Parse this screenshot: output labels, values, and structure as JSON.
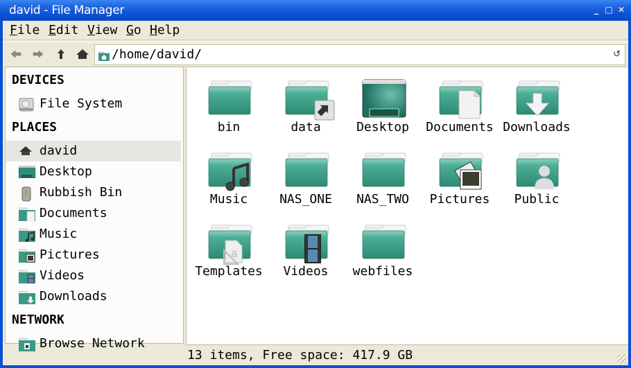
{
  "window": {
    "title": "david - File Manager",
    "controls": [
      "minimize",
      "maximize",
      "close"
    ]
  },
  "menubar": [
    {
      "label": "File",
      "mnemonic": "F",
      "rest": "ile"
    },
    {
      "label": "Edit",
      "mnemonic": "E",
      "rest": "dit"
    },
    {
      "label": "View",
      "mnemonic": "V",
      "rest": "iew"
    },
    {
      "label": "Go",
      "mnemonic": "G",
      "rest": "o"
    },
    {
      "label": "Help",
      "mnemonic": "H",
      "rest": "elp"
    }
  ],
  "toolbar": {
    "back_icon": "arrow-left-icon",
    "forward_icon": "arrow-right-icon",
    "up_icon": "arrow-up-icon",
    "home_icon": "home-icon",
    "location": "/home/david/",
    "reload_icon": "reload-icon"
  },
  "sidebar": {
    "devices_heading": "DEVICES",
    "devices": [
      {
        "label": "File System",
        "icon": "harddisk-icon"
      }
    ],
    "places_heading": "PLACES",
    "places": [
      {
        "label": "david",
        "icon": "home-icon",
        "selected": true
      },
      {
        "label": "Desktop",
        "icon": "desktop-icon"
      },
      {
        "label": "Rubbish Bin",
        "icon": "trash-icon"
      },
      {
        "label": "Documents",
        "icon": "folder-documents-icon"
      },
      {
        "label": "Music",
        "icon": "folder-music-icon"
      },
      {
        "label": "Pictures",
        "icon": "folder-pictures-icon"
      },
      {
        "label": "Videos",
        "icon": "folder-videos-icon"
      },
      {
        "label": "Downloads",
        "icon": "folder-downloads-icon"
      }
    ],
    "network_heading": "NETWORK",
    "network": [
      {
        "label": "Browse Network",
        "icon": "network-folder-icon"
      }
    ]
  },
  "files": [
    {
      "name": "bin",
      "icon": "folder"
    },
    {
      "name": "data",
      "icon": "folder-link"
    },
    {
      "name": "Desktop",
      "icon": "desktop"
    },
    {
      "name": "Documents",
      "icon": "folder-documents"
    },
    {
      "name": "Downloads",
      "icon": "folder-downloads"
    },
    {
      "name": "Music",
      "icon": "folder-music"
    },
    {
      "name": "NAS_ONE",
      "icon": "folder"
    },
    {
      "name": "NAS_TWO",
      "icon": "folder"
    },
    {
      "name": "Pictures",
      "icon": "folder-pictures"
    },
    {
      "name": "Public",
      "icon": "folder-public"
    },
    {
      "name": "Templates",
      "icon": "folder-templates"
    },
    {
      "name": "Videos",
      "icon": "folder-videos"
    },
    {
      "name": "webfiles",
      "icon": "folder"
    }
  ],
  "status": {
    "text": "13 items, Free space: 417.9 GB"
  },
  "colors": {
    "titlebar": "#0d52d4",
    "folder_teal": "#3a9a85",
    "window_bg": "#ece9d8",
    "selection": "#e6e6e3"
  }
}
